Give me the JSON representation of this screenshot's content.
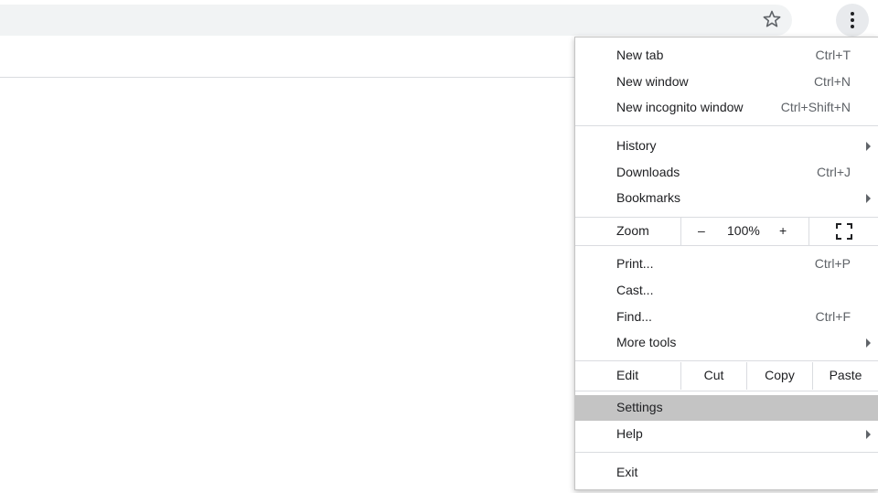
{
  "toolbar": {
    "star_icon": "star-outline-icon",
    "menu_icon": "three-dots-vertical-icon"
  },
  "menu": {
    "group1": [
      {
        "label": "New tab",
        "shortcut": "Ctrl+T"
      },
      {
        "label": "New window",
        "shortcut": "Ctrl+N"
      },
      {
        "label": "New incognito window",
        "shortcut": "Ctrl+Shift+N"
      }
    ],
    "group2": [
      {
        "label": "History",
        "shortcut": ""
      },
      {
        "label": "Downloads",
        "shortcut": "Ctrl+J"
      },
      {
        "label": "Bookmarks",
        "shortcut": ""
      }
    ],
    "zoom": {
      "label": "Zoom",
      "minus": "–",
      "value": "100%",
      "plus": "+"
    },
    "group3": [
      {
        "label": "Print...",
        "shortcut": "Ctrl+P"
      },
      {
        "label": "Cast...",
        "shortcut": ""
      },
      {
        "label": "Find...",
        "shortcut": "Ctrl+F"
      },
      {
        "label": "More tools",
        "shortcut": ""
      }
    ],
    "edit": {
      "label": "Edit",
      "cut": "Cut",
      "copy": "Copy",
      "paste": "Paste"
    },
    "group4": [
      {
        "label": "Settings",
        "shortcut": "",
        "highlighted": true
      },
      {
        "label": "Help",
        "shortcut": ""
      }
    ],
    "exit": {
      "label": "Exit"
    }
  },
  "colors": {
    "highlight": "#c4c4c4",
    "omnibox": "#f1f3f4"
  }
}
